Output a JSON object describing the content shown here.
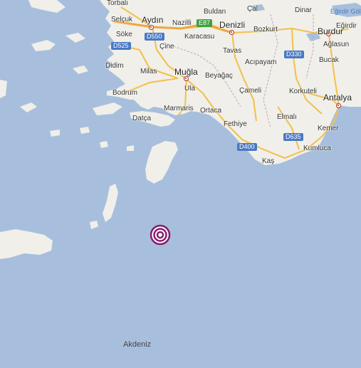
{
  "map": {
    "sea_label": "Akdeniz",
    "lake_label": "Eğirdir Göl",
    "cities": [
      {
        "id": "torbali",
        "name": "Torbalı",
        "marker": false
      },
      {
        "id": "selcuk",
        "name": "Selçuk",
        "marker": false
      },
      {
        "id": "aydin",
        "name": "Aydın",
        "marker": true
      },
      {
        "id": "buldan",
        "name": "Buldan",
        "marker": false
      },
      {
        "id": "cal",
        "name": "Çal",
        "marker": false
      },
      {
        "id": "dinar",
        "name": "Dinar",
        "marker": false
      },
      {
        "id": "nazilli",
        "name": "Nazilli",
        "marker": false
      },
      {
        "id": "denizli",
        "name": "Denizli",
        "marker": true
      },
      {
        "id": "bozkurt",
        "name": "Bozkurt",
        "marker": false
      },
      {
        "id": "burdur",
        "name": "Burdur",
        "marker": true
      },
      {
        "id": "egirdir",
        "name": "Eğirdir",
        "marker": false
      },
      {
        "id": "soke",
        "name": "Söke",
        "marker": false
      },
      {
        "id": "karacasu",
        "name": "Karacasu",
        "marker": false
      },
      {
        "id": "cine",
        "name": "Çine",
        "marker": false
      },
      {
        "id": "aglasun",
        "name": "Ağlasun",
        "marker": false
      },
      {
        "id": "tavas",
        "name": "Tavas",
        "marker": false
      },
      {
        "id": "acipayam",
        "name": "Acıpayam",
        "marker": false
      },
      {
        "id": "bucak",
        "name": "Bucak",
        "marker": false
      },
      {
        "id": "didim",
        "name": "Didim",
        "marker": false
      },
      {
        "id": "milas",
        "name": "Milas",
        "marker": false
      },
      {
        "id": "mugla",
        "name": "Muğla",
        "marker": true
      },
      {
        "id": "beyagac",
        "name": "Beyağaç",
        "marker": false
      },
      {
        "id": "ula",
        "name": "Ula",
        "marker": false
      },
      {
        "id": "bodrum",
        "name": "Bodrum",
        "marker": false
      },
      {
        "id": "cameli",
        "name": "Çameli",
        "marker": false
      },
      {
        "id": "korkuteli",
        "name": "Korkuteli",
        "marker": false
      },
      {
        "id": "antalya",
        "name": "Antalya",
        "marker": true
      },
      {
        "id": "marmaris",
        "name": "Marmaris",
        "marker": false
      },
      {
        "id": "ortaca",
        "name": "Ortaca",
        "marker": false
      },
      {
        "id": "datca",
        "name": "Datça",
        "marker": false
      },
      {
        "id": "elmali",
        "name": "Elmalı",
        "marker": false
      },
      {
        "id": "fethiye",
        "name": "Fethiye",
        "marker": false
      },
      {
        "id": "kemer",
        "name": "Kemer",
        "marker": false
      },
      {
        "id": "kumluca",
        "name": "Kumluca",
        "marker": false
      },
      {
        "id": "kas",
        "name": "Kaş",
        "marker": false
      }
    ],
    "roads": [
      {
        "id": "e87",
        "label": "E87",
        "color": "#3ca23c"
      },
      {
        "id": "d550",
        "label": "D550",
        "color": "#4a78c4"
      },
      {
        "id": "d525",
        "label": "D525",
        "color": "#4a78c4"
      },
      {
        "id": "d330",
        "label": "D330",
        "color": "#4a78c4"
      },
      {
        "id": "d400",
        "label": "D400",
        "color": "#4a78c4"
      },
      {
        "id": "d635",
        "label": "D635",
        "color": "#4a78c4"
      }
    ],
    "epicenter": {
      "color": "#8a1c6e"
    },
    "colors": {
      "sea": "#a7bfdc",
      "land": "#f0efe9",
      "road": "#f2c04a",
      "highway": "#f0a63a"
    }
  }
}
